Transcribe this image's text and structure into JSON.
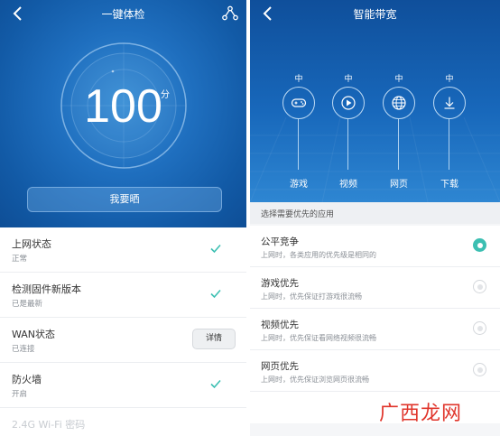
{
  "left": {
    "title": "一键体检",
    "score": "100",
    "score_unit": "分",
    "show_button": "我要晒",
    "items": [
      {
        "label": "上网状态",
        "status": "正常",
        "action": "check"
      },
      {
        "label": "检测固件新版本",
        "status": "已是最新",
        "action": "check"
      },
      {
        "label": "WAN状态",
        "status": "已连接",
        "action": "button",
        "button_label": "详情"
      },
      {
        "label": "防火墙",
        "status": "开启",
        "action": "check"
      }
    ],
    "partial_item": "2.4G Wi-Fi 密码"
  },
  "right": {
    "title": "智能带宽",
    "categories": [
      {
        "name": "游戏",
        "level": "中",
        "icon": "gamepad-icon"
      },
      {
        "name": "视频",
        "level": "中",
        "icon": "play-icon"
      },
      {
        "name": "网页",
        "level": "中",
        "icon": "globe-icon"
      },
      {
        "name": "下载",
        "level": "中",
        "icon": "download-icon"
      }
    ],
    "section_label": "选择需要优先的应用",
    "options": [
      {
        "title": "公平竞争",
        "desc": "上网时，各类应用的优先级是相同的",
        "selected": true
      },
      {
        "title": "游戏优先",
        "desc": "上网时，优先保证打游戏很流畅",
        "selected": false
      },
      {
        "title": "视频优先",
        "desc": "上网时，优先保证看网络视频很流畅",
        "selected": false
      },
      {
        "title": "网页优先",
        "desc": "上网时，优先保证浏览网页很流畅",
        "selected": false
      }
    ]
  },
  "watermark": "广西龙网",
  "colors": {
    "accent": "#3cbfb2",
    "header_blue": "#1f6fbf"
  }
}
